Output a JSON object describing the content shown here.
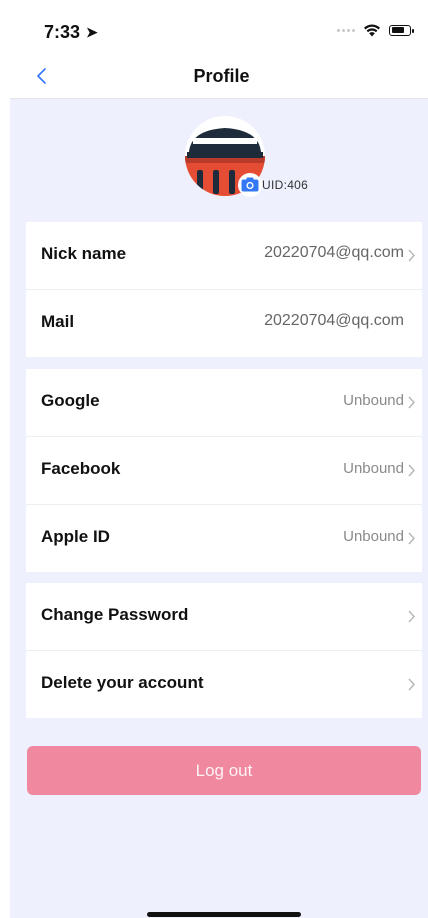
{
  "status_bar": {
    "time": "7:33"
  },
  "nav": {
    "title": "Profile"
  },
  "profile": {
    "uid": "UID:406"
  },
  "account_group": [
    {
      "label": "Nick name",
      "value": "20220704@qq.com"
    },
    {
      "label": "Mail",
      "value": "20220704@qq.com"
    }
  ],
  "social_group": [
    {
      "label": "Google",
      "value": "Unbound"
    },
    {
      "label": "Facebook",
      "value": "Unbound"
    },
    {
      "label": "Apple ID",
      "value": "Unbound"
    }
  ],
  "security_group": [
    {
      "label": "Change Password"
    },
    {
      "label": "Delete your account"
    }
  ],
  "logout_label": "Log out",
  "colors": {
    "background": "#eef1fd",
    "logout": "#f0899f",
    "accent": "#3478f6"
  }
}
